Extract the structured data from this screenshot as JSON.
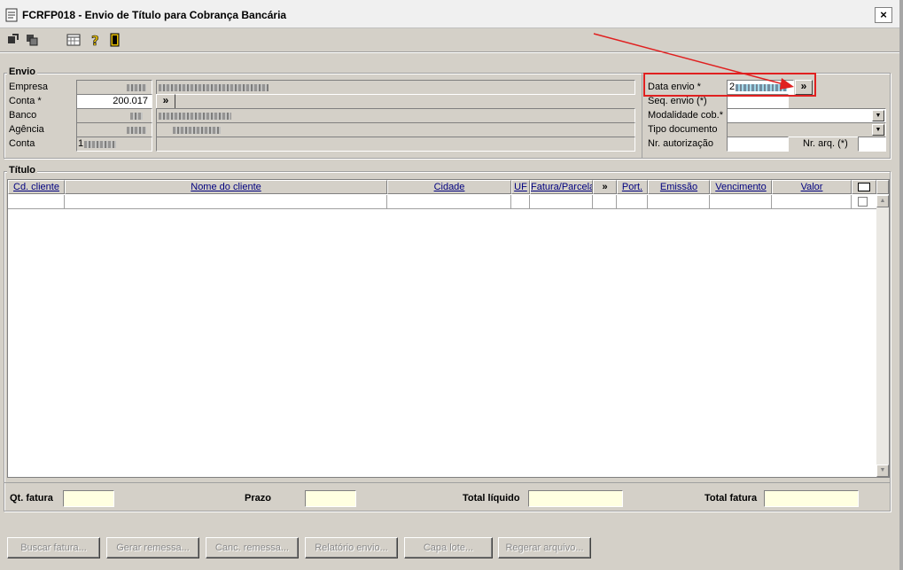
{
  "window": {
    "title": "FCRFP018 - Envio de Título para Cobrança Bancária",
    "close_label": "×"
  },
  "toolbar": {
    "icons": [
      "export-icon",
      "copy-icon",
      "calendar-grid-icon",
      "help-icon",
      "exit-door-icon"
    ]
  },
  "envio": {
    "group_title": "Envio",
    "labels": {
      "empresa": "Empresa",
      "conta_req": "Conta *",
      "banco": "Banco",
      "agencia": "Agência",
      "conta": "Conta",
      "data_envio": "Data envio *",
      "seq_envio": "Seq. envio (*)",
      "modalidade": "Modalidade cob.*",
      "tipo_documento": "Tipo documento",
      "nr_autorizacao": "Nr. autorização",
      "nr_arq": "Nr. arq. (*)"
    },
    "conta_value": "200.017",
    "conta_prefix": "1",
    "data_envio_prefix": "2",
    "lookup_label": "»"
  },
  "titulo": {
    "group_title": "Título",
    "columns": [
      "Cd. cliente",
      "Nome do cliente",
      "Cidade",
      "UF",
      "Fatura/Parcela",
      "»",
      "Port.",
      "Emissão",
      "Vencimento",
      "Valor"
    ]
  },
  "totals": {
    "qt_fatura": "Qt. fatura",
    "prazo": "Prazo",
    "total_liquido": "Total líquido",
    "total_fatura": "Total fatura"
  },
  "buttons": {
    "buscar": "Buscar fatura...",
    "gerar": "Gerar remessa...",
    "canc": "Canc. remessa...",
    "relatorio": "Relatório envio...",
    "capa": "Capa lote...",
    "regerar": "Regerar arquivo..."
  },
  "colors": {
    "highlight_box": "#e02020",
    "arrow": "#e02020",
    "total_fields": "#ffffe1",
    "column_header_text": "#00007f"
  }
}
